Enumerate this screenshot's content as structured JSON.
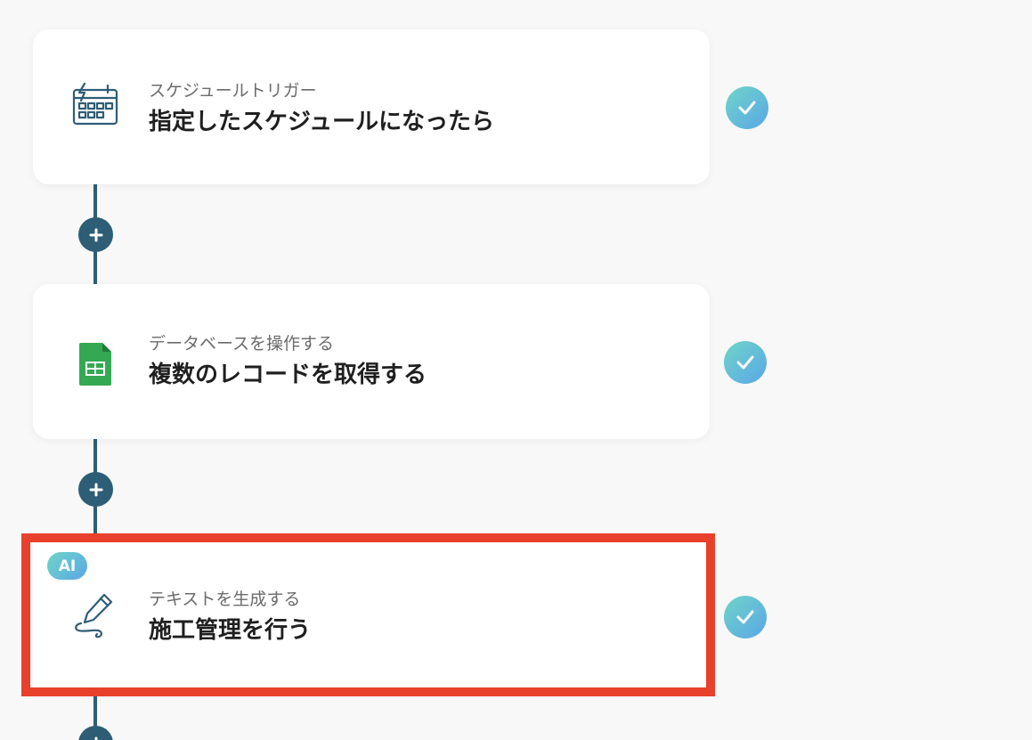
{
  "colors": {
    "connector": "#2e5d76",
    "highlight": "#e8402a",
    "check_gradient_start": "#6fd4c8",
    "check_gradient_end": "#5aa7e6",
    "sheets_green": "#34a853"
  },
  "steps": [
    {
      "type_label": "スケジュールトリガー",
      "title": "指定したスケジュールになったら",
      "icon": "schedule-trigger-icon",
      "status": "completed"
    },
    {
      "type_label": "データベースを操作する",
      "title": "複数のレコードを取得する",
      "icon": "google-sheets-icon",
      "status": "completed"
    },
    {
      "badge": "AI",
      "type_label": "テキストを生成する",
      "title": "施工管理を行う",
      "icon": "pen-write-icon",
      "status": "completed",
      "highlighted": true
    }
  ]
}
